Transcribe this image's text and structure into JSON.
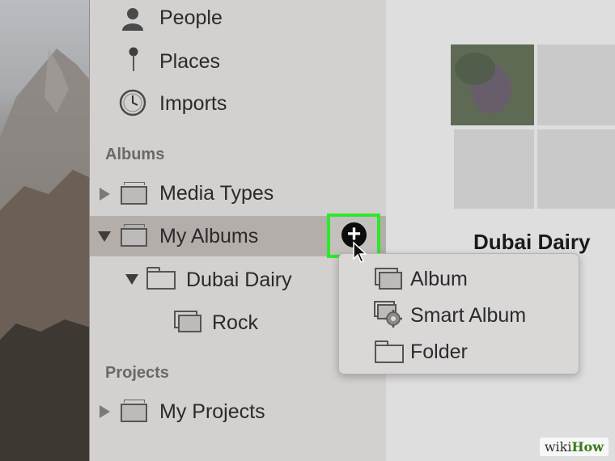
{
  "sidebar": {
    "library_items": [
      {
        "label": "People",
        "icon": "person-icon"
      },
      {
        "label": "Places",
        "icon": "pin-icon"
      },
      {
        "label": "Imports",
        "icon": "clock-icon"
      }
    ],
    "albums_section": "Albums",
    "albums": [
      {
        "label": "Media Types",
        "expanded": false
      },
      {
        "label": "My Albums",
        "expanded": true,
        "selected": true
      },
      {
        "label": "Dubai Dairy",
        "expanded": true
      },
      {
        "label": "Rock"
      }
    ],
    "projects_section": "Projects",
    "projects": [
      {
        "label": "My Projects",
        "expanded": false
      }
    ]
  },
  "add_button": {
    "symbol": "+",
    "highlight_color": "#2de82a"
  },
  "main": {
    "album_title": "Dubai Dairy"
  },
  "context_menu": {
    "items": [
      {
        "label": "Album",
        "icon": "album-icon"
      },
      {
        "label": "Smart Album",
        "icon": "smart-album-gear-icon"
      },
      {
        "label": "Folder",
        "icon": "folder-icon"
      }
    ]
  },
  "watermark": {
    "prefix": "wiki",
    "suffix": "How"
  }
}
